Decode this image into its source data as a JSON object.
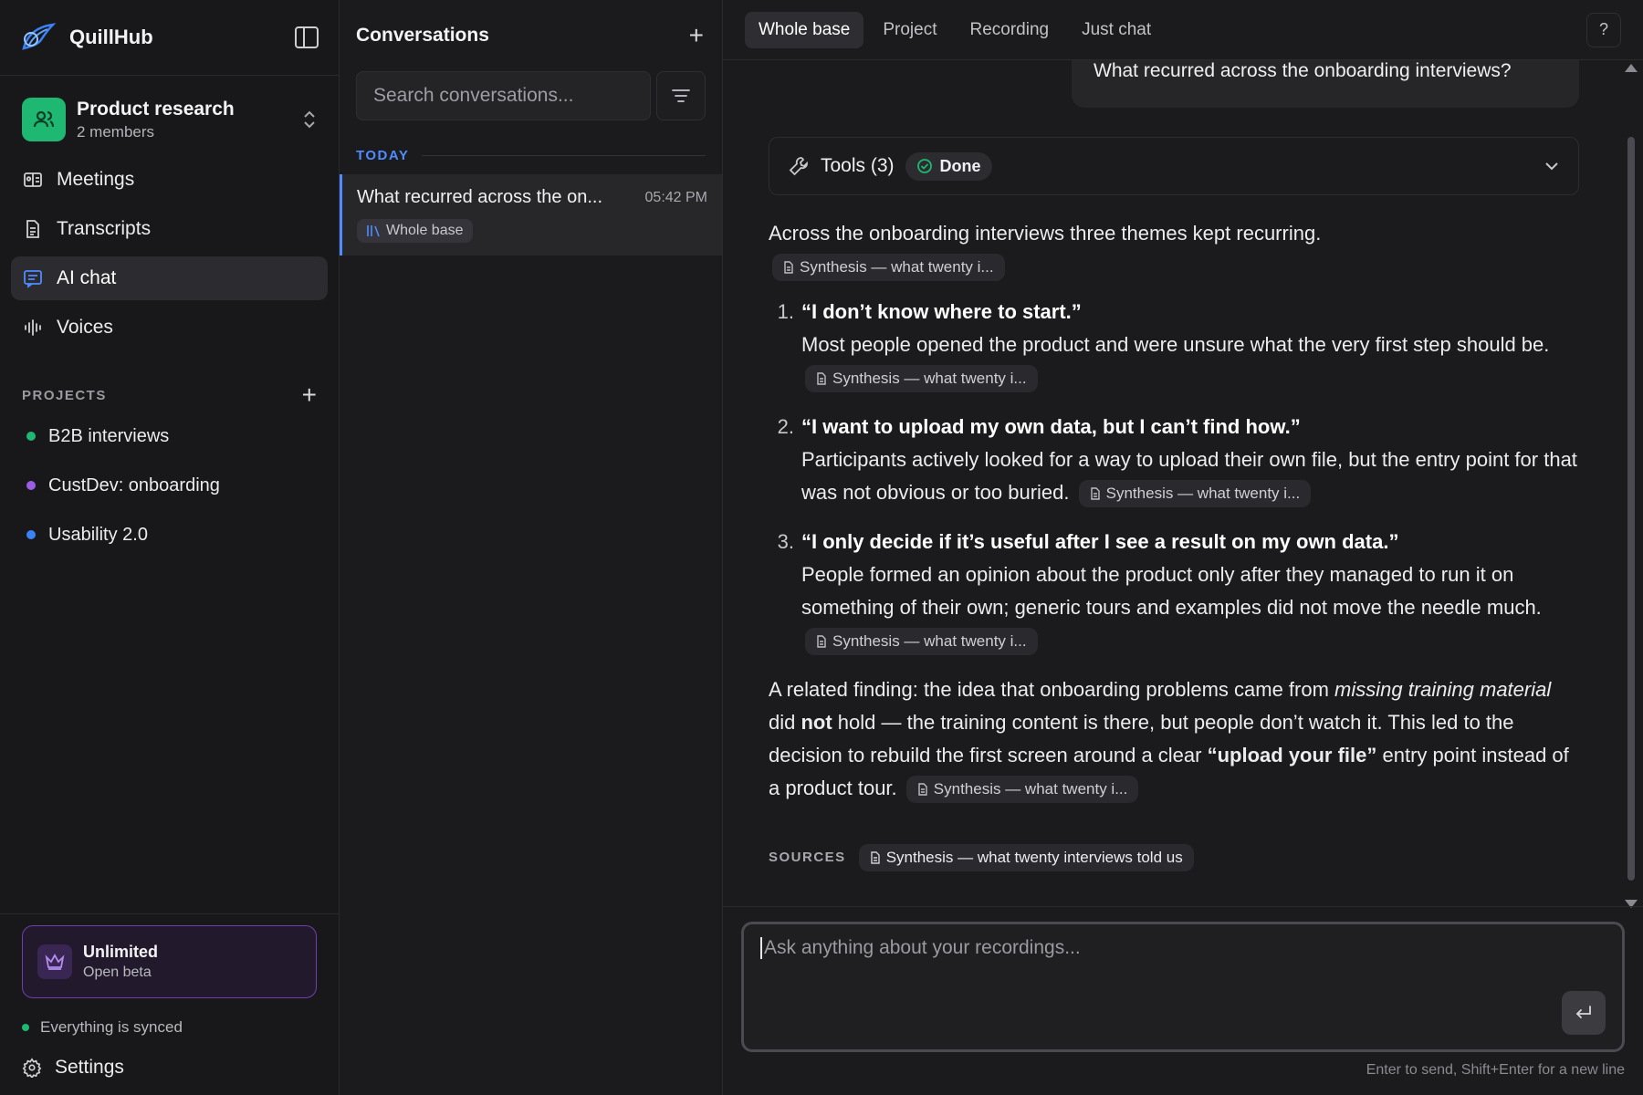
{
  "app": {
    "name": "QuillHub"
  },
  "workspace": {
    "name": "Product research",
    "members": "2 members"
  },
  "nav": [
    {
      "label": "Meetings",
      "icon": "meetings-icon"
    },
    {
      "label": "Transcripts",
      "icon": "document-icon"
    },
    {
      "label": "AI chat",
      "icon": "chat-icon",
      "active": true
    },
    {
      "label": "Voices",
      "icon": "waveform-icon"
    }
  ],
  "projects": {
    "label": "PROJECTS",
    "items": [
      {
        "label": "B2B interviews",
        "color": "#1fb872"
      },
      {
        "label": "CustDev: onboarding",
        "color": "#9b5de5"
      },
      {
        "label": "Usability 2.0",
        "color": "#3b82f6"
      }
    ]
  },
  "plan": {
    "title": "Unlimited",
    "subtitle": "Open beta"
  },
  "sync": {
    "status": "Everything is synced",
    "color": "#1fb872"
  },
  "settings": {
    "label": "Settings"
  },
  "conversations": {
    "title": "Conversations",
    "search_placeholder": "Search conversations...",
    "group": "TODAY",
    "items": [
      {
        "title": "What recurred across the on...",
        "time": "05:42 PM",
        "tag": "Whole base"
      }
    ]
  },
  "tabs": [
    {
      "label": "Whole base",
      "active": true
    },
    {
      "label": "Project"
    },
    {
      "label": "Recording"
    },
    {
      "label": "Just chat"
    }
  ],
  "help": {
    "label": "?"
  },
  "chat": {
    "user_message": "What recurred across the onboarding interviews?",
    "tools": {
      "label": "Tools (3)",
      "status": "Done"
    },
    "intro": "Across the onboarding interviews three themes kept recurring.",
    "cite_short": "Synthesis — what twenty i...",
    "themes": [
      {
        "num": "1.",
        "title": "“I don’t know where to start.”",
        "text": "Most people opened the product and were unsure what the very first step should be."
      },
      {
        "num": "2.",
        "title": "“I want to upload my own data, but I can’t find how.”",
        "text": "Participants actively looked for a way to upload their own file, but the entry point for that was not obvious or too buried."
      },
      {
        "num": "3.",
        "title": "“I only decide if it’s useful after I see a result on my own data.”",
        "text": "People formed an opinion about the product only after they managed to run it on something of their own; generic tours and examples did not move the needle much."
      }
    ],
    "finding": {
      "p1": "A related finding: the idea that onboarding problems came from ",
      "em": "missing training material",
      "p2": " did ",
      "strong1": "not",
      "p3": " hold — the training content is there, but people don’t watch it. This led to the decision to rebuild the first screen around a clear ",
      "strong2": "“upload your file”",
      "p4": " entry point instead of a product tour."
    },
    "sources_label": "SOURCES",
    "source_full": "Synthesis — what twenty interviews told us"
  },
  "composer": {
    "placeholder": "Ask anything about your recordings...",
    "hint": "Enter to send, Shift+Enter for a new line"
  },
  "colors": {
    "accent": "#4f8cff",
    "brand": "#1fb872",
    "plan_border": "#6e3fb0"
  }
}
